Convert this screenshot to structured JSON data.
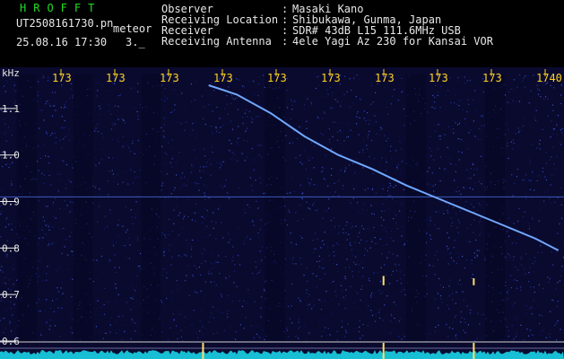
{
  "header": {
    "app_title": "HROFFT",
    "file_name": "UT2508161730.pn",
    "file_tag": "meteor",
    "timestamp": "25.08.16 17:30",
    "timestamp_value": "3._",
    "info": [
      {
        "label": "Observer",
        "value": "Masaki Kano"
      },
      {
        "label": "Receiving Location",
        "value": "Shibukawa, Gunma, Japan"
      },
      {
        "label": "Receiver",
        "value": "SDR# 43dB L15 111.6MHz USB"
      },
      {
        "label": "Receiving Antenna",
        "value": "4ele Yagi Az 230 for Kansai VOR"
      }
    ],
    "separator": ":"
  },
  "colors": {
    "background": "#0a0a2e",
    "trace": "#6fa8ff",
    "tick_text": "#ffd21f",
    "axis_text": "#e8e8e8",
    "spectrum": "#19d2e6",
    "title": "#22dd22"
  },
  "chart_data": {
    "type": "heatmap",
    "title": "",
    "ylabel": "kHz",
    "xlabel": "",
    "x_tick_labels": [
      "173",
      "173",
      "173",
      "173",
      "173",
      "173",
      "173",
      "173",
      "173",
      "1740"
    ],
    "y_ticks": [
      1.1,
      1.0,
      0.9,
      0.8,
      0.7,
      0.6
    ],
    "y_tick_labels": [
      "1.1",
      "1.0",
      "0.9",
      "0.8",
      "0.7",
      "0.6"
    ],
    "ylim": [
      0.6,
      1.15
    ],
    "grid": false,
    "reference_line_y": 0.91,
    "meteor_trace": {
      "x": [
        0.37,
        0.42,
        0.48,
        0.54,
        0.6,
        0.66,
        0.72,
        0.78,
        0.84,
        0.9,
        0.95,
        0.99
      ],
      "y": [
        1.15,
        1.13,
        1.09,
        1.04,
        1.0,
        0.97,
        0.935,
        0.905,
        0.875,
        0.845,
        0.82,
        0.795
      ]
    },
    "pings": [
      {
        "x": 0.68,
        "y_top": 0.74,
        "y_bottom": 0.72
      },
      {
        "x": 0.84,
        "y_top": 0.735,
        "y_bottom": 0.72
      }
    ]
  }
}
